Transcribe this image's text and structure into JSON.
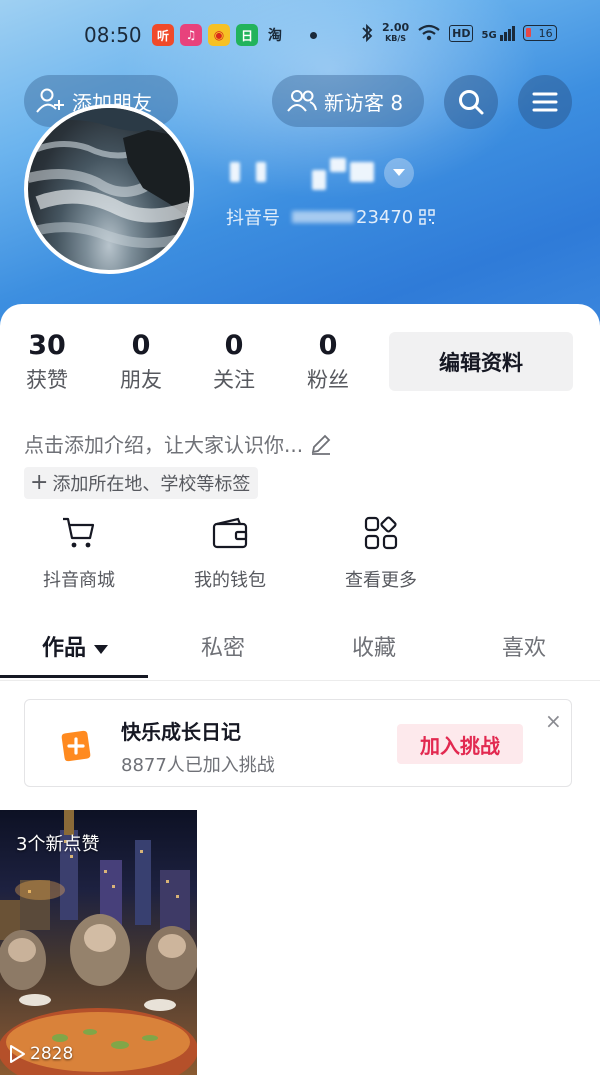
{
  "status_bar": {
    "time": "08:50",
    "speed_value": "2.00",
    "speed_unit": "KB/S",
    "network": "5G",
    "hd": "HD",
    "battery": "16"
  },
  "header": {
    "add_friend_label": "添加朋友",
    "visitors_label": "新访客 8",
    "douyin_id_prefix": "抖音号",
    "douyin_id_suffix": "23470"
  },
  "stats": [
    {
      "value": "30",
      "label": "获赞"
    },
    {
      "value": "0",
      "label": "朋友"
    },
    {
      "value": "0",
      "label": "关注"
    },
    {
      "value": "0",
      "label": "粉丝"
    }
  ],
  "edit_profile_label": "编辑资料",
  "bio_placeholder": "点击添加介绍，让大家认识你...",
  "tag_button_label": "添加所在地、学校等标签",
  "quick_actions": [
    {
      "label": "抖音商城",
      "icon": "cart-icon"
    },
    {
      "label": "我的钱包",
      "icon": "wallet-icon"
    },
    {
      "label": "查看更多",
      "icon": "grid-icon"
    }
  ],
  "tabs": [
    {
      "label": "作品",
      "active": true
    },
    {
      "label": "私密",
      "active": false
    },
    {
      "label": "收藏",
      "active": false
    },
    {
      "label": "喜欢",
      "active": false
    }
  ],
  "challenge_card": {
    "title": "快乐成长日记",
    "subtitle": "8877人已加入挑战",
    "button_label": "加入挑战",
    "close_symbol": "×"
  },
  "video": {
    "new_likes": "3个新点赞",
    "plays": "2828"
  },
  "colors": {
    "accent": "#e22950",
    "orange": "#ff8a1f",
    "header_blue": "#3d8fe0"
  }
}
